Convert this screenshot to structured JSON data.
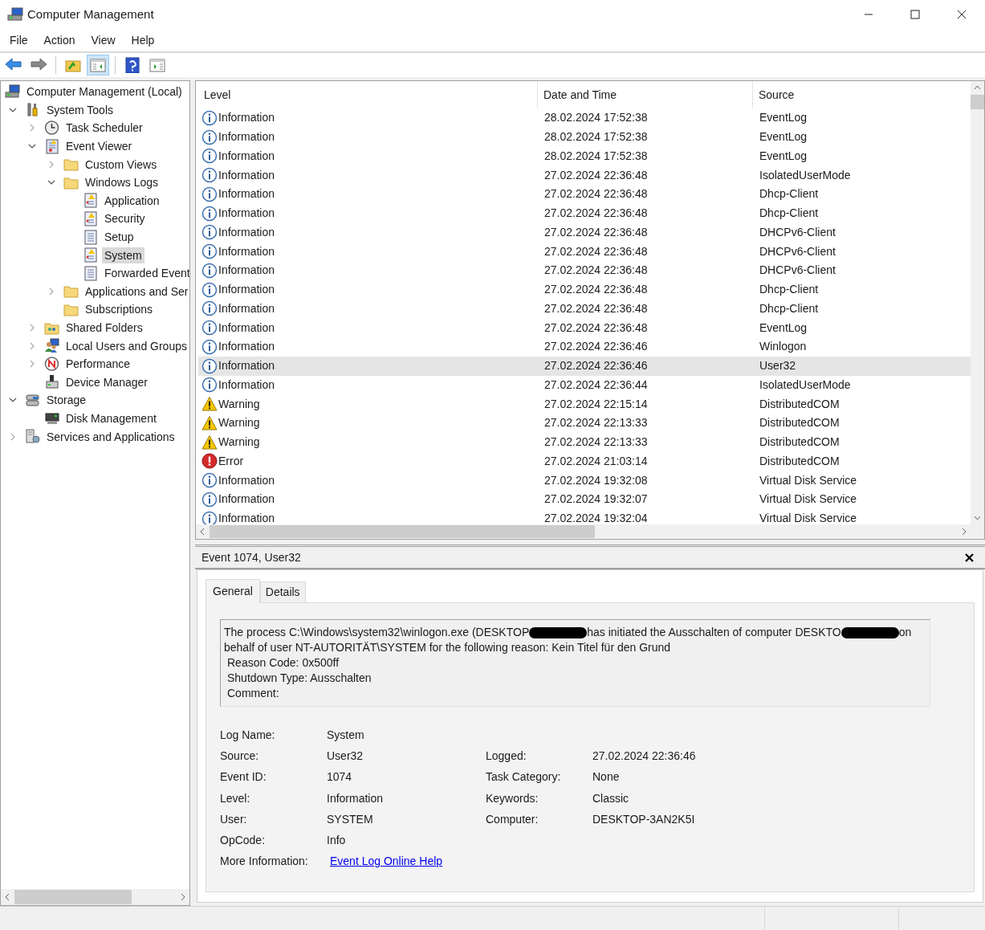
{
  "window": {
    "title": "Computer Management"
  },
  "menu": [
    "File",
    "Action",
    "View",
    "Help"
  ],
  "toolbar": [
    {
      "kind": "back",
      "pressed": false
    },
    {
      "kind": "forward",
      "pressed": false
    },
    {
      "kind": "sep"
    },
    {
      "kind": "up",
      "pressed": false
    },
    {
      "kind": "tree",
      "pressed": true
    },
    {
      "kind": "sep"
    },
    {
      "kind": "help",
      "pressed": false
    },
    {
      "kind": "pane",
      "pressed": false
    }
  ],
  "tree": [
    {
      "label": "Computer Management (Local)",
      "kind": "computer",
      "selected": false,
      "children": [
        {
          "label": "System Tools",
          "kind": "tools",
          "expanded": true,
          "selected": false,
          "children": [
            {
              "label": "Task Scheduler",
              "kind": "clock",
              "expanded": false,
              "selected": false
            },
            {
              "label": "Event Viewer",
              "kind": "viewer",
              "expanded": true,
              "selected": false,
              "children": [
                {
                  "label": "Custom Views",
                  "kind": "folder",
                  "expanded": false,
                  "selected": false
                },
                {
                  "label": "Windows Logs",
                  "kind": "folder",
                  "expanded": true,
                  "selected": false,
                  "children": [
                    {
                      "label": "Application",
                      "kind": "logwarn",
                      "selected": false
                    },
                    {
                      "label": "Security",
                      "kind": "logwarn",
                      "selected": false
                    },
                    {
                      "label": "Setup",
                      "kind": "log",
                      "selected": false
                    },
                    {
                      "label": "System",
                      "kind": "logwarn",
                      "selected": true
                    },
                    {
                      "label": "Forwarded Event",
                      "kind": "log",
                      "selected": false
                    }
                  ]
                },
                {
                  "label": "Applications and Ser",
                  "kind": "folder",
                  "expanded": false,
                  "selected": false
                },
                {
                  "label": "Subscriptions",
                  "kind": "folder",
                  "selected": false
                }
              ]
            },
            {
              "label": "Shared Folders",
              "kind": "share",
              "expanded": false,
              "selected": false
            },
            {
              "label": "Local Users and Groups",
              "kind": "users",
              "expanded": false,
              "selected": false
            },
            {
              "label": "Performance",
              "kind": "gauge",
              "expanded": false,
              "selected": false
            },
            {
              "label": "Device Manager",
              "kind": "device",
              "selected": false
            }
          ]
        },
        {
          "label": "Storage",
          "kind": "storage",
          "expanded": true,
          "selected": false,
          "children": [
            {
              "label": "Disk Management",
              "kind": "disk",
              "selected": false
            }
          ]
        },
        {
          "label": "Services and Applications",
          "kind": "server",
          "expanded": false,
          "selected": false
        }
      ]
    }
  ],
  "table": {
    "columns": [
      "Level",
      "Date and Time",
      "Source"
    ],
    "rows": [
      {
        "kind": "information",
        "level": "Information",
        "date": "28.02.2024 17:52:38",
        "source": "EventLog",
        "selected": false
      },
      {
        "kind": "information",
        "level": "Information",
        "date": "28.02.2024 17:52:38",
        "source": "EventLog",
        "selected": false
      },
      {
        "kind": "information",
        "level": "Information",
        "date": "28.02.2024 17:52:38",
        "source": "EventLog",
        "selected": false
      },
      {
        "kind": "information",
        "level": "Information",
        "date": "27.02.2024 22:36:48",
        "source": "IsolatedUserMode",
        "selected": false
      },
      {
        "kind": "information",
        "level": "Information",
        "date": "27.02.2024 22:36:48",
        "source": "Dhcp-Client",
        "selected": false
      },
      {
        "kind": "information",
        "level": "Information",
        "date": "27.02.2024 22:36:48",
        "source": "Dhcp-Client",
        "selected": false
      },
      {
        "kind": "information",
        "level": "Information",
        "date": "27.02.2024 22:36:48",
        "source": "DHCPv6-Client",
        "selected": false
      },
      {
        "kind": "information",
        "level": "Information",
        "date": "27.02.2024 22:36:48",
        "source": "DHCPv6-Client",
        "selected": false
      },
      {
        "kind": "information",
        "level": "Information",
        "date": "27.02.2024 22:36:48",
        "source": "DHCPv6-Client",
        "selected": false
      },
      {
        "kind": "information",
        "level": "Information",
        "date": "27.02.2024 22:36:48",
        "source": "Dhcp-Client",
        "selected": false
      },
      {
        "kind": "information",
        "level": "Information",
        "date": "27.02.2024 22:36:48",
        "source": "Dhcp-Client",
        "selected": false
      },
      {
        "kind": "information",
        "level": "Information",
        "date": "27.02.2024 22:36:48",
        "source": "EventLog",
        "selected": false
      },
      {
        "kind": "information",
        "level": "Information",
        "date": "27.02.2024 22:36:46",
        "source": "Winlogon",
        "selected": false
      },
      {
        "kind": "information",
        "level": "Information",
        "date": "27.02.2024 22:36:46",
        "source": "User32",
        "selected": true
      },
      {
        "kind": "information",
        "level": "Information",
        "date": "27.02.2024 22:36:44",
        "source": "IsolatedUserMode",
        "selected": false
      },
      {
        "kind": "warning",
        "level": "Warning",
        "date": "27.02.2024 22:15:14",
        "source": "DistributedCOM",
        "selected": false
      },
      {
        "kind": "warning",
        "level": "Warning",
        "date": "27.02.2024 22:13:33",
        "source": "DistributedCOM",
        "selected": false
      },
      {
        "kind": "warning",
        "level": "Warning",
        "date": "27.02.2024 22:13:33",
        "source": "DistributedCOM",
        "selected": false
      },
      {
        "kind": "error",
        "level": "Error",
        "date": "27.02.2024 21:03:14",
        "source": "DistributedCOM",
        "selected": false
      },
      {
        "kind": "information",
        "level": "Information",
        "date": "27.02.2024 19:32:08",
        "source": "Virtual Disk Service",
        "selected": false
      },
      {
        "kind": "information",
        "level": "Information",
        "date": "27.02.2024 19:32:07",
        "source": "Virtual Disk Service",
        "selected": false
      },
      {
        "kind": "information",
        "level": "Information",
        "date": "27.02.2024 19:32:04",
        "source": "Virtual Disk Service",
        "selected": false
      }
    ]
  },
  "detail": {
    "title": "Event 1074, User32",
    "tabs": [
      {
        "label": "General",
        "selected": true
      },
      {
        "label": "Details",
        "selected": false
      }
    ],
    "message": [
      {
        "kind": "text",
        "text": "The process C:\\Windows\\system32\\winlogon.exe (DESKTOP"
      },
      {
        "kind": "redaction"
      },
      {
        "kind": "text",
        "text": "has initiated the Ausschalten of computer DESKTO"
      },
      {
        "kind": "redaction"
      },
      {
        "kind": "text",
        "text": "on"
      },
      {
        "kind": "break",
        "text": "behalf of user NT-AUTORITÄT\\SYSTEM for the following reason: Kein Titel für den Grund"
      },
      {
        "kind": "line",
        "text": "Reason Code: 0x500ff"
      },
      {
        "kind": "line",
        "text": "Shutdown Type: Ausschalten"
      },
      {
        "kind": "line",
        "text": "Comment:"
      }
    ],
    "fields_left": [
      {
        "label": "Log Name:",
        "value": "System"
      },
      {
        "label": "Source:",
        "value": "User32"
      },
      {
        "label": "Event ID:",
        "value": "1074"
      },
      {
        "label": "Level:",
        "value": "Information"
      },
      {
        "label": "User:",
        "value": "SYSTEM"
      },
      {
        "label": "OpCode:",
        "value": "Info"
      }
    ],
    "fields_right": [
      {
        "label": "Logged:",
        "value": "27.02.2024 22:36:46"
      },
      {
        "label": "Task Category:",
        "value": "None"
      },
      {
        "label": "Keywords:",
        "value": "Classic"
      },
      {
        "label": "Computer:",
        "value": "DESKTOP-3AN2K5I"
      }
    ],
    "more_info": {
      "label": "More Information:",
      "link": "Event Log Online Help"
    }
  }
}
